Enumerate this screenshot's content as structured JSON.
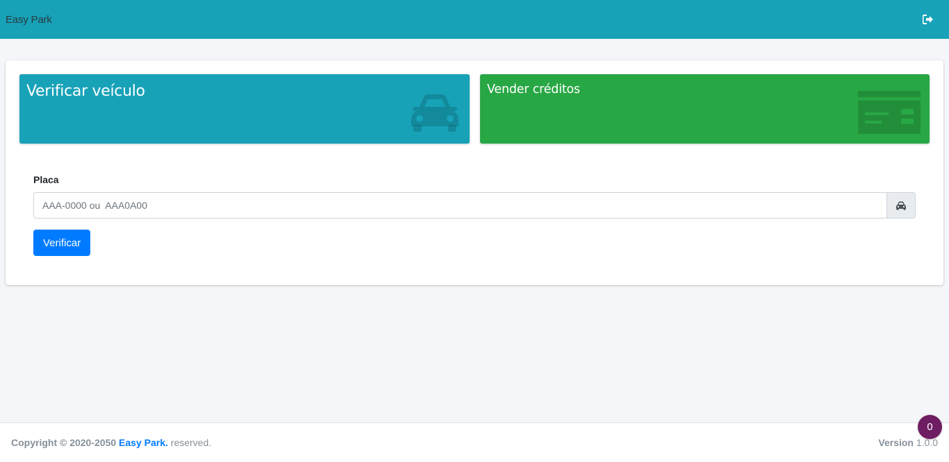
{
  "navbar": {
    "brand": "Easy Park",
    "logout_icon": "sign-out-icon"
  },
  "tiles": {
    "verify": {
      "title": "Verificar veículo",
      "icon": "car-icon",
      "color": "#17a2b8"
    },
    "sell": {
      "title": "Vender créditos",
      "icon": "credit-card-icon",
      "color": "#28a745"
    }
  },
  "form": {
    "label": "Placa",
    "placeholder": "AAA-0000 ou  AAA0A00",
    "value": "",
    "addon_icon": "car-icon",
    "submit_label": "Verificar"
  },
  "footer": {
    "copyright_prefix": "Copyright © 2020-2050",
    "brand_link": "Easy Park.",
    "reserved": "reserved.",
    "version_label": "Version",
    "version_value": "1.0.0"
  },
  "badge": {
    "count": "0",
    "color": "#6f1d62"
  }
}
